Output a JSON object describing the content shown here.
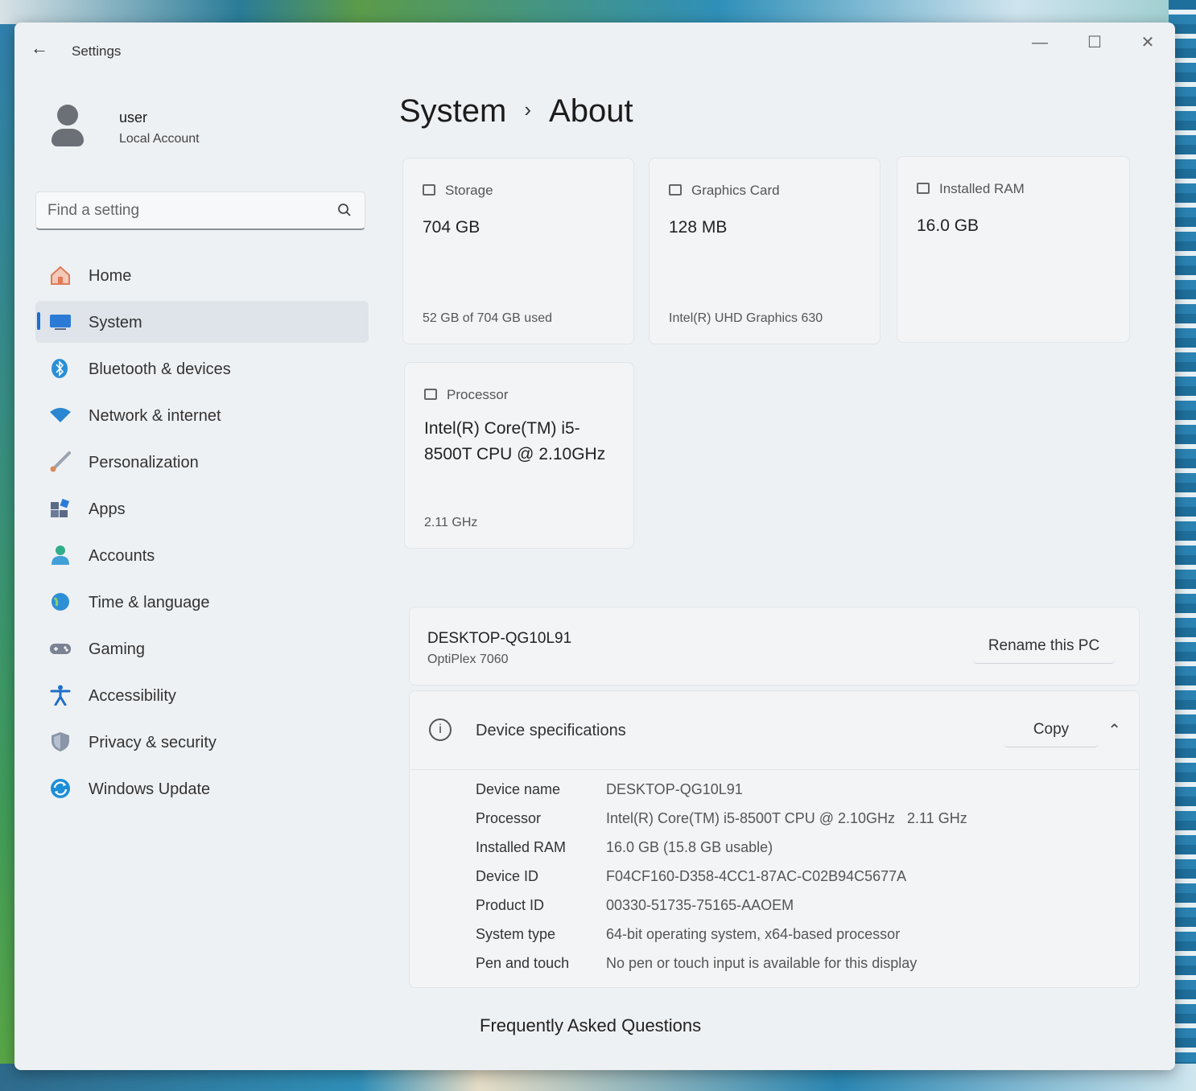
{
  "window": {
    "title": "Settings"
  },
  "user": {
    "name": "user",
    "account_type": "Local Account"
  },
  "search": {
    "placeholder": "Find a setting"
  },
  "sidebar": {
    "items": [
      {
        "label": "Home",
        "icon": "home-icon",
        "color": "#e07b5a"
      },
      {
        "label": "System",
        "icon": "system-icon",
        "color": "#2b7bd6",
        "active": true
      },
      {
        "label": "Bluetooth & devices",
        "icon": "bluetooth-icon",
        "color": "#2b8fd6"
      },
      {
        "label": "Network & internet",
        "icon": "wifi-icon",
        "color": "#2a86d0"
      },
      {
        "label": "Personalization",
        "icon": "brush-icon",
        "color": "#d98a5a"
      },
      {
        "label": "Apps",
        "icon": "apps-icon",
        "color": "#5a6a86"
      },
      {
        "label": "Accounts",
        "icon": "accounts-icon",
        "color": "#2fae8a"
      },
      {
        "label": "Time & language",
        "icon": "globe-clock-icon",
        "color": "#2f8fd6"
      },
      {
        "label": "Gaming",
        "icon": "gamepad-icon",
        "color": "#7a8294"
      },
      {
        "label": "Accessibility",
        "icon": "accessibility-icon",
        "color": "#1f6fc8"
      },
      {
        "label": "Privacy & security",
        "icon": "shield-icon",
        "color": "#8a96a8"
      },
      {
        "label": "Windows Update",
        "icon": "update-icon",
        "color": "#1d8fd8"
      }
    ]
  },
  "breadcrumb": {
    "parent": "System",
    "separator": "›",
    "current": "About"
  },
  "cards": {
    "storage": {
      "title": "Storage",
      "value": "704 GB",
      "sub": "52 GB of 704 GB used"
    },
    "graphics": {
      "title": "Graphics Card",
      "value": "128 MB",
      "sub": "Intel(R) UHD Graphics 630"
    },
    "ram": {
      "title": "Installed RAM",
      "value": "16.0 GB"
    },
    "processor": {
      "title": "Processor",
      "value": "Intel(R) Core(TM) i5-8500T CPU @ 2.10GHz",
      "sub": "2.11 GHz"
    }
  },
  "pc": {
    "name": "DESKTOP-QG10L91",
    "model": "OptiPlex 7060",
    "rename_label": "Rename this PC"
  },
  "specs": {
    "title": "Device specifications",
    "copy_label": "Copy",
    "rows": [
      {
        "label": "Device name",
        "value": "DESKTOP-QG10L91"
      },
      {
        "label": "Processor",
        "value": "Intel(R) Core(TM) i5-8500T CPU @ 2.10GHz   2.11 GHz"
      },
      {
        "label": "Installed RAM",
        "value": "16.0 GB (15.8 GB usable)"
      },
      {
        "label": "Device ID",
        "value": "F04CF160-D358-4CC1-87AC-C02B94C5677A"
      },
      {
        "label": "Product ID",
        "value": "00330-51735-75165-AAOEM"
      },
      {
        "label": "System type",
        "value": "64-bit operating system, x64-based processor"
      },
      {
        "label": "Pen and touch",
        "value": "No pen or touch input is available for this display"
      }
    ]
  },
  "faq": {
    "label": "Frequently Asked Questions"
  }
}
